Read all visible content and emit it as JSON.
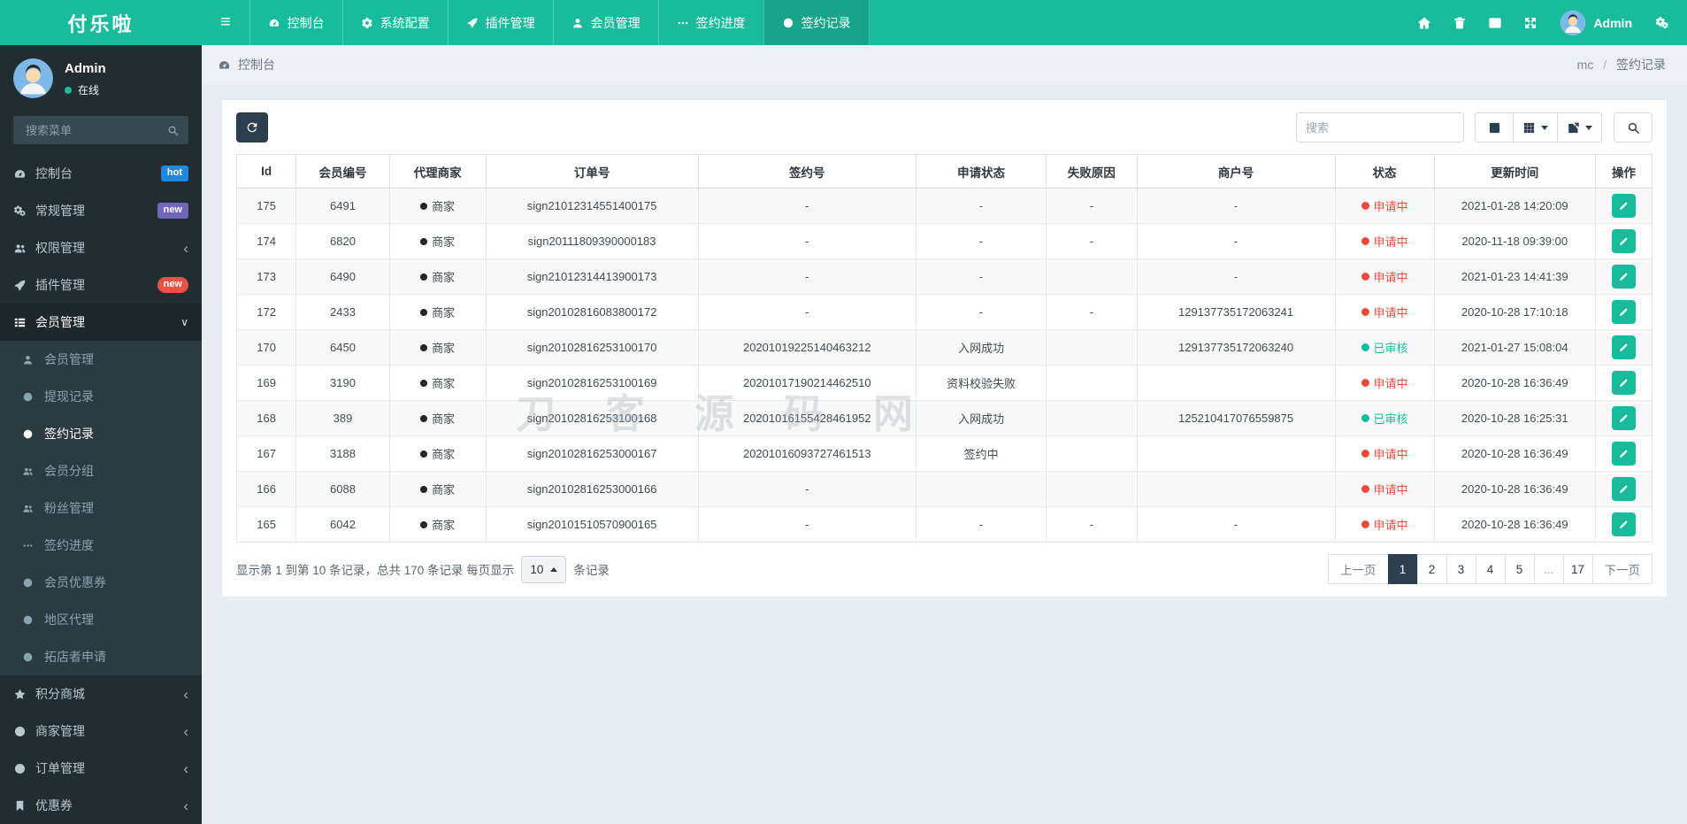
{
  "brand": {
    "logo": "付乐啦"
  },
  "topbar": {
    "tabs": [
      {
        "key": "console",
        "icon": "dashboard",
        "label": "控制台"
      },
      {
        "key": "system-config",
        "icon": "gear",
        "label": "系统配置"
      },
      {
        "key": "plugins",
        "icon": "rocket",
        "label": "插件管理"
      },
      {
        "key": "members",
        "icon": "person",
        "label": "会员管理"
      },
      {
        "key": "sign-progress",
        "icon": "ellipsis",
        "label": "签约进度"
      },
      {
        "key": "sign-records",
        "icon": "circle",
        "label": "签约记录",
        "active": true
      }
    ],
    "right_icons": [
      {
        "key": "home",
        "icon": "home"
      },
      {
        "key": "trash",
        "icon": "trash"
      },
      {
        "key": "image",
        "icon": "image"
      },
      {
        "key": "expand",
        "icon": "expand"
      }
    ],
    "user_name": "Admin"
  },
  "sidebar": {
    "user": {
      "name": "Admin",
      "status": "在线"
    },
    "search_placeholder": "搜索菜单",
    "items": [
      {
        "key": "console",
        "icon": "dashboard",
        "label": "控制台",
        "badge": {
          "text": "hot",
          "type": "blue"
        }
      },
      {
        "key": "general",
        "icon": "gears",
        "label": "常规管理",
        "badge": {
          "text": "new",
          "type": "purple"
        }
      },
      {
        "key": "permissions",
        "icon": "users",
        "label": "权限管理",
        "chevron": "left"
      },
      {
        "key": "plugins",
        "icon": "rocket",
        "label": "插件管理",
        "badge": {
          "text": "new",
          "type": "red-pill"
        }
      },
      {
        "key": "members",
        "icon": "list",
        "label": "会员管理",
        "chevron": "down",
        "active": true,
        "children": [
          {
            "key": "member-list",
            "icon": "person",
            "label": "会员管理"
          },
          {
            "key": "withdraw-records",
            "icon": "circle",
            "label": "提现记录"
          },
          {
            "key": "sign-records",
            "icon": "circle",
            "label": "签约记录",
            "active": true
          },
          {
            "key": "member-groups",
            "icon": "users",
            "label": "会员分组"
          },
          {
            "key": "fans",
            "icon": "users",
            "label": "粉丝管理"
          },
          {
            "key": "sign-progress",
            "icon": "ellipsis",
            "label": "签约进度"
          },
          {
            "key": "member-coupons",
            "icon": "circle",
            "label": "会员优惠券"
          },
          {
            "key": "region-agents",
            "icon": "circle",
            "label": "地区代理"
          },
          {
            "key": "shop-applications",
            "icon": "circle",
            "label": "拓店者申请"
          }
        ]
      },
      {
        "key": "points-mall",
        "icon": "star",
        "label": "积分商城",
        "chevron": "left"
      },
      {
        "key": "merchants",
        "icon": "circle",
        "label": "商家管理",
        "chevron": "left"
      },
      {
        "key": "orders",
        "icon": "circle",
        "label": "订单管理",
        "chevron": "left"
      },
      {
        "key": "coupons",
        "icon": "bookmark",
        "label": "优惠券",
        "chevron": "left"
      }
    ]
  },
  "breadcrumb": {
    "left": "控制台",
    "right_parent": "mc",
    "right_current": "签约记录"
  },
  "toolbar": {
    "search_placeholder": "搜索"
  },
  "table": {
    "columns": [
      "Id",
      "会员编号",
      "代理商家",
      "订单号",
      "签约号",
      "申请状态",
      "失败原因",
      "商户号",
      "状态",
      "更新时间",
      "操作"
    ],
    "agent_label": "商家",
    "rows": [
      {
        "id": "175",
        "member": "6491",
        "agent": true,
        "order": "sign21012314551400175",
        "sign": "-",
        "app_status": "-",
        "fail": "-",
        "merchant": "-",
        "status": "申请中",
        "status_type": "red",
        "updated": "2021-01-28 14:20:09"
      },
      {
        "id": "174",
        "member": "6820",
        "agent": true,
        "order": "sign20111809390000183",
        "sign": "-",
        "app_status": "-",
        "fail": "-",
        "merchant": "-",
        "status": "申请中",
        "status_type": "red",
        "updated": "2020-11-18 09:39:00"
      },
      {
        "id": "173",
        "member": "6490",
        "agent": true,
        "order": "sign21012314413900173",
        "sign": "-",
        "app_status": "-",
        "fail": "",
        "merchant": "-",
        "status": "申请中",
        "status_type": "red",
        "updated": "2021-01-23 14:41:39"
      },
      {
        "id": "172",
        "member": "2433",
        "agent": true,
        "order": "sign20102816083800172",
        "sign": "-",
        "app_status": "-",
        "fail": "-",
        "merchant": "129137735172063241",
        "status": "申请中",
        "status_type": "red",
        "updated": "2020-10-28 17:10:18"
      },
      {
        "id": "170",
        "member": "6450",
        "agent": true,
        "order": "sign20102816253100170",
        "sign": "20201019225140463212",
        "app_status": "入网成功",
        "fail": "",
        "merchant": "129137735172063240",
        "status": "已审核",
        "status_type": "green",
        "updated": "2021-01-27 15:08:04"
      },
      {
        "id": "169",
        "member": "3190",
        "agent": true,
        "order": "sign20102816253100169",
        "sign": "20201017190214462510",
        "app_status": "资料校验失败",
        "fail": "",
        "merchant": "",
        "status": "申请中",
        "status_type": "red",
        "updated": "2020-10-28 16:36:49"
      },
      {
        "id": "168",
        "member": "389",
        "agent": true,
        "order": "sign20102816253100168",
        "sign": "20201016155428461952",
        "app_status": "入网成功",
        "fail": "",
        "merchant": "125210417076559875",
        "status": "已审核",
        "status_type": "green",
        "updated": "2020-10-28 16:25:31"
      },
      {
        "id": "167",
        "member": "3188",
        "agent": true,
        "order": "sign20102816253000167",
        "sign": "20201016093727461513",
        "app_status": "签约中",
        "fail": "",
        "merchant": "",
        "status": "申请中",
        "status_type": "red",
        "updated": "2020-10-28 16:36:49"
      },
      {
        "id": "166",
        "member": "6088",
        "agent": true,
        "order": "sign20102816253000166",
        "sign": "-",
        "app_status": "",
        "fail": "",
        "merchant": "",
        "status": "申请中",
        "status_type": "red",
        "updated": "2020-10-28 16:36:49"
      },
      {
        "id": "165",
        "member": "6042",
        "agent": true,
        "order": "sign20101510570900165",
        "sign": "-",
        "app_status": "-",
        "fail": "-",
        "merchant": "-",
        "status": "申请中",
        "status_type": "red",
        "updated": "2020-10-28 16:36:49"
      }
    ]
  },
  "watermark": "刀客源码网",
  "footer": {
    "text_before": "显示第 1 到第 10 条记录，总共 170 条记录 每页显示",
    "page_size": "10",
    "text_after": "条记录"
  },
  "pagination": {
    "prev": "上一页",
    "next": "下一页",
    "pages": [
      "1",
      "2",
      "3",
      "4",
      "5",
      "...",
      "17"
    ],
    "active": "1"
  },
  "colors": {
    "brand_green": "#18bc9c",
    "topbar_active": "#17a589",
    "sidebar_bg": "#222d32",
    "submenu_bg": "#2c3b41",
    "dark_navy": "#2c3e50",
    "status_red": "#e74c3c",
    "status_green": "#18bc9c",
    "badge_blue": "#1e88e5",
    "badge_purple": "#7266ba",
    "badge_red": "#ed5044"
  }
}
